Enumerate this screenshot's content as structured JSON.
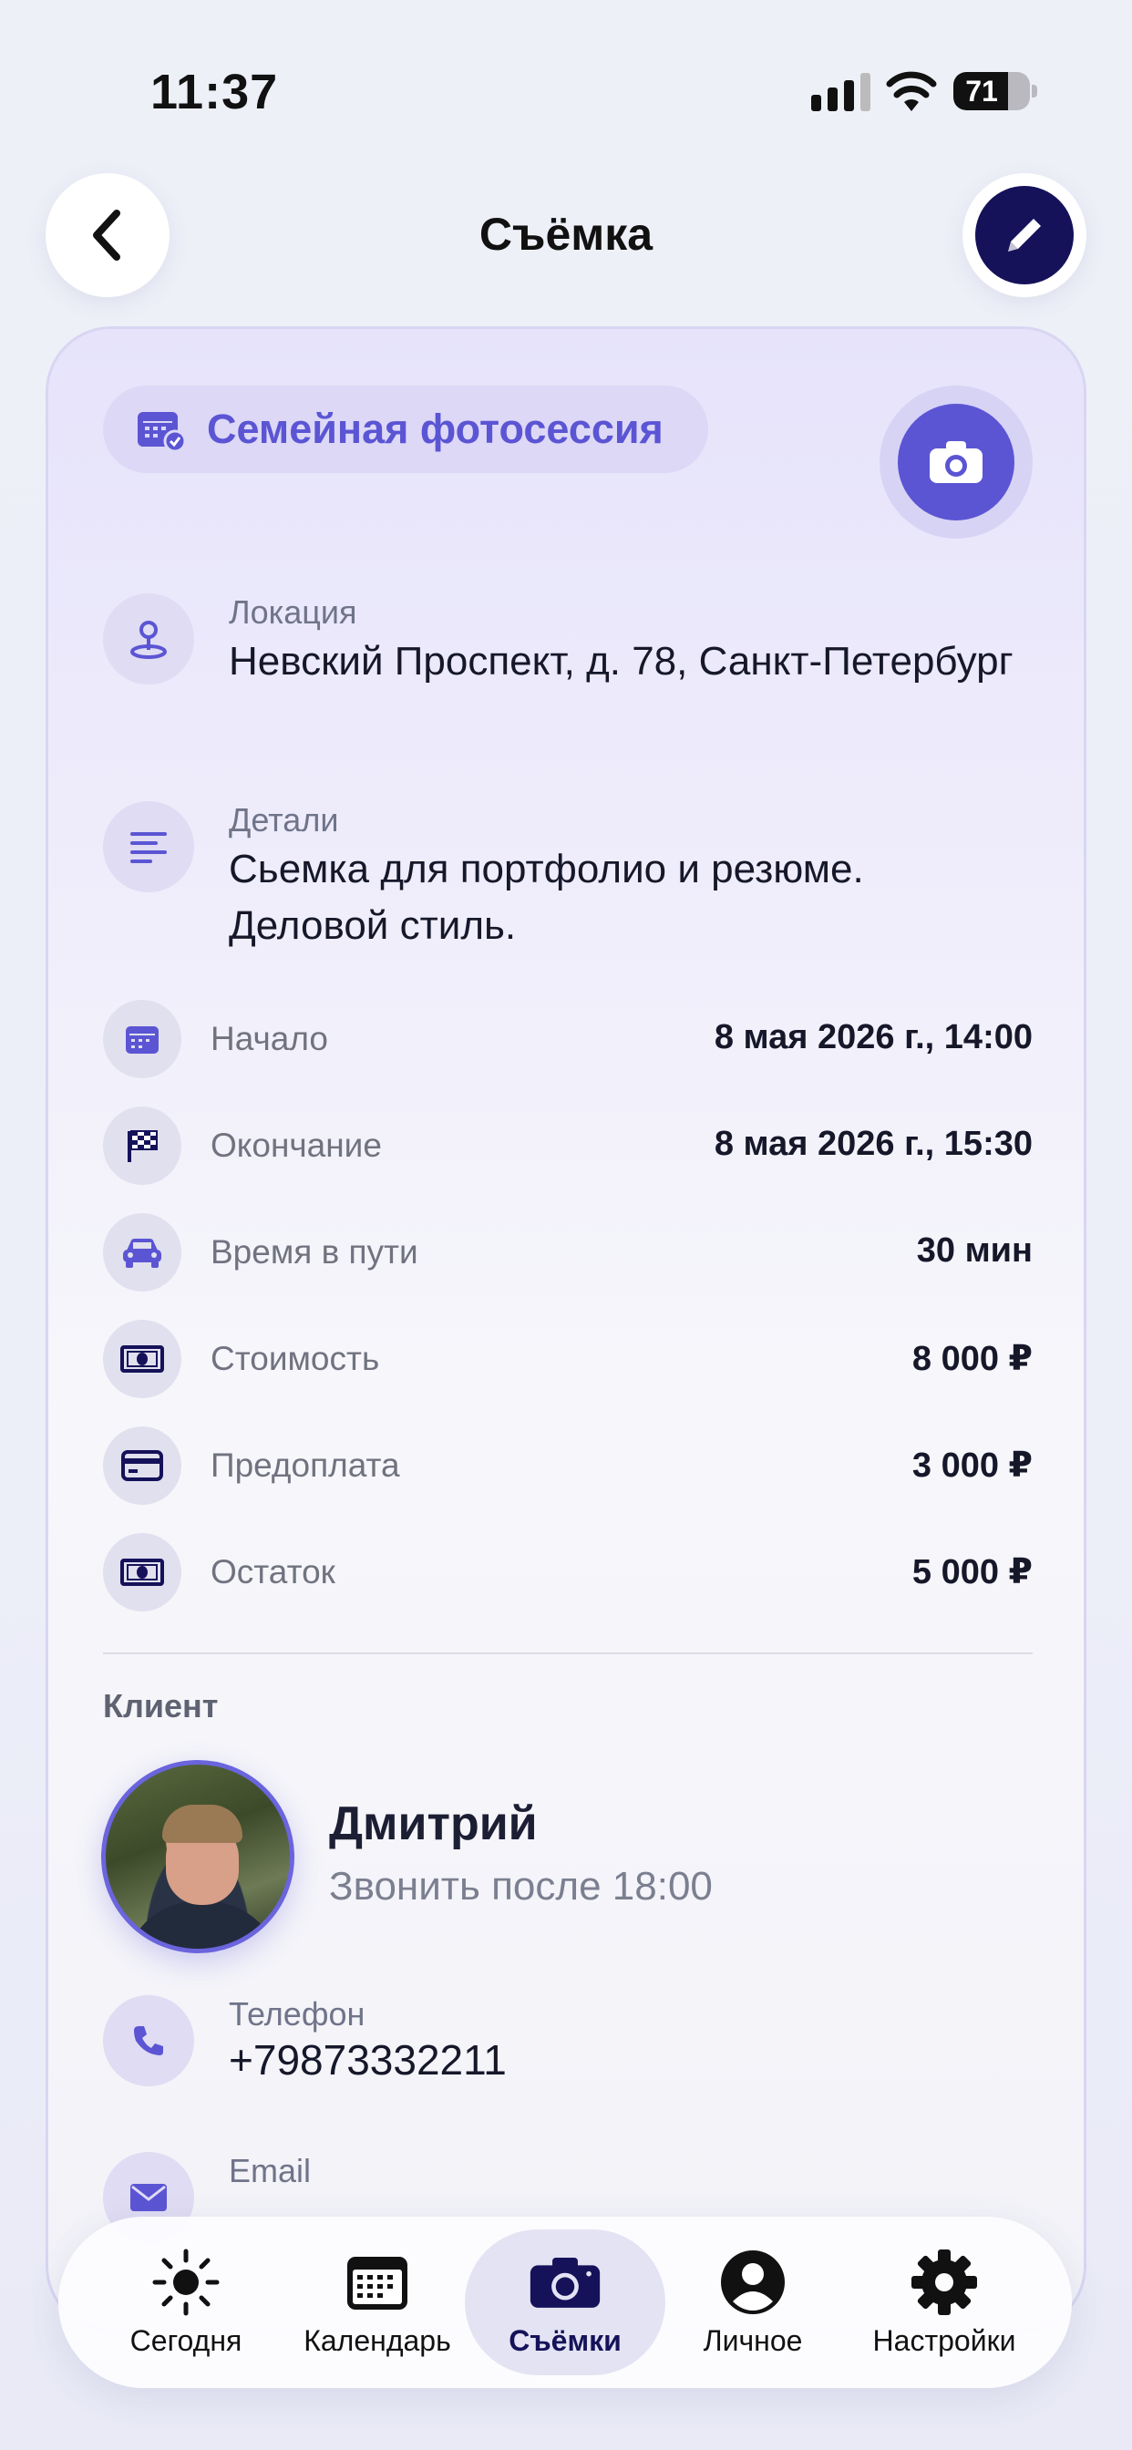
{
  "status_bar": {
    "time": "11:37",
    "battery": "71",
    "battery_level": 0.71
  },
  "header": {
    "title": "Съёмка"
  },
  "shoot": {
    "type_label": "Семейная фотосессия",
    "location_label": "Локация",
    "location_value": "Невский Проспект, д. 78, Санкт-Петербург",
    "details_label": "Детали",
    "details_value": "Сьемка для портфолио и резюме. Деловой стиль.",
    "rows": [
      {
        "label": "Начало",
        "value": "8 мая 2026 г., 14:00",
        "icon": "calendar-icon"
      },
      {
        "label": "Окончание",
        "value": "8 мая 2026 г., 15:30",
        "icon": "finish-flag-icon"
      },
      {
        "label": "Время в пути",
        "value": "30 мин",
        "icon": "car-icon"
      },
      {
        "label": "Стоимость",
        "value": "8 000 ₽",
        "icon": "banknote-icon"
      },
      {
        "label": "Предоплата",
        "value": "3 000 ₽",
        "icon": "credit-card-icon"
      },
      {
        "label": "Остаток",
        "value": "5 000 ₽",
        "icon": "banknote-icon"
      }
    ]
  },
  "client": {
    "section_label": "Клиент",
    "name": "Дмитрий",
    "note": "Звонить после 18:00",
    "phone_label": "Телефон",
    "phone_value": "+79873332211",
    "email_label": "Email"
  },
  "tabs": [
    {
      "label": "Сегодня",
      "icon": "sun-icon",
      "active": false
    },
    {
      "label": "Календарь",
      "icon": "calendar-icon",
      "active": false
    },
    {
      "label": "Съёмки",
      "icon": "camera-icon",
      "active": true
    },
    {
      "label": "Личное",
      "icon": "person-icon",
      "active": false
    },
    {
      "label": "Настройки",
      "icon": "gear-icon",
      "active": false
    }
  ],
  "colors": {
    "accent": "#5b55d4",
    "dark_accent": "#15125a",
    "chip_bg": "#dcd8f6"
  }
}
